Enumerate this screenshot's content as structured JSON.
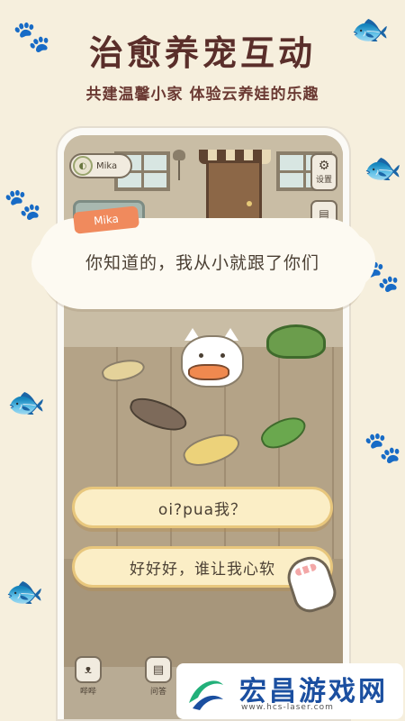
{
  "header": {
    "headline": "治愈养宠互动",
    "subline": "共建温馨小家 体验云养娃的乐趣"
  },
  "game": {
    "profile_name": "Mika",
    "settings_label": "设置",
    "speaker_name": "Mika",
    "dialogue": "你知道的，我从小就跟了你们",
    "answers": [
      "oi?pua我？",
      "好好好，谁让我心软"
    ],
    "nav": [
      {
        "label": "哔哔",
        "icon": "cat-face-icon"
      },
      {
        "label": "问答",
        "icon": "notebook-icon"
      }
    ]
  },
  "watermark": {
    "title": "宏昌游戏网",
    "url": "www.hcs-laser.com"
  },
  "colors": {
    "headline": "#5a2e2a",
    "name_tag": "#f08a5d",
    "answer_fill": "#fbeec6",
    "answer_border": "#e8c77d",
    "watermark_title": "#1b4fa0"
  }
}
